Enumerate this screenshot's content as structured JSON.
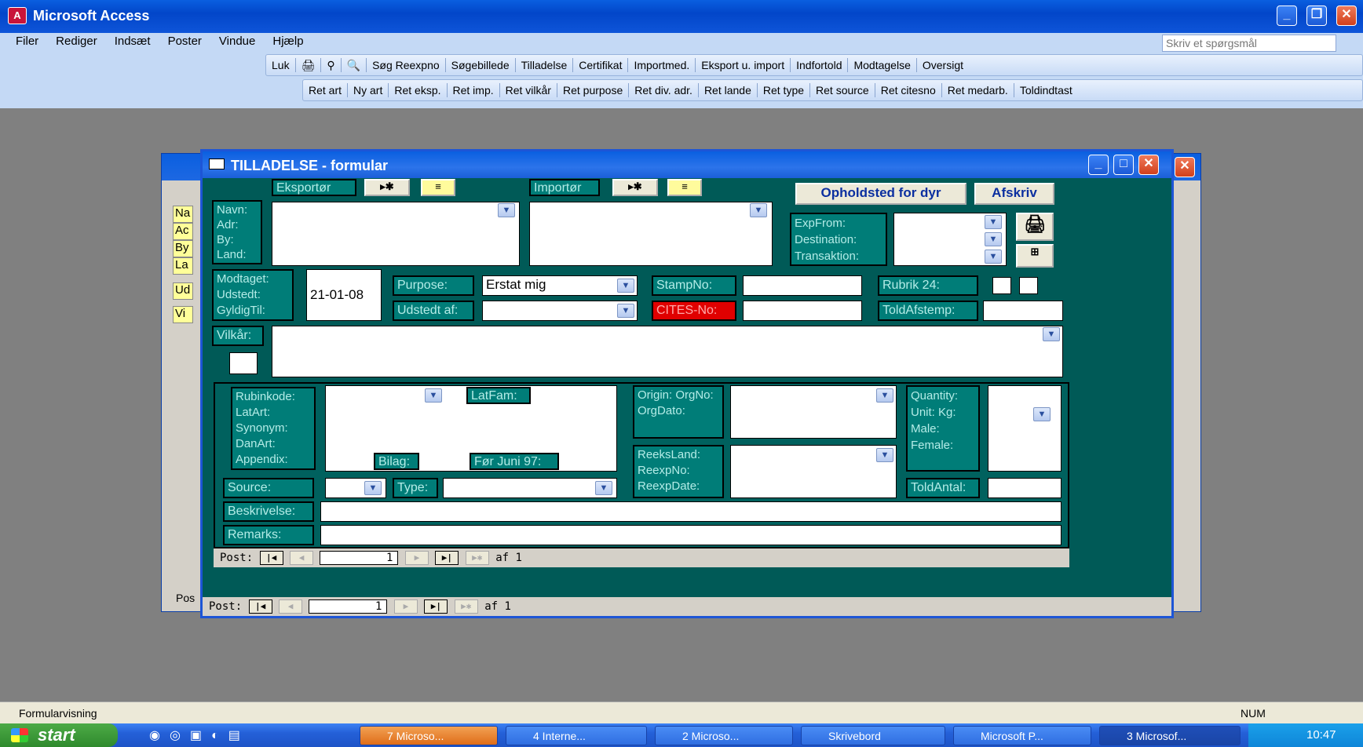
{
  "app": {
    "title": "Microsoft Access",
    "icon": "access-icon"
  },
  "menu": [
    "Filer",
    "Rediger",
    "Indsæt",
    "Poster",
    "Vindue",
    "Hjælp"
  ],
  "ask_placeholder": "Skriv et spørgsmål",
  "toolbar1": [
    "Luk",
    "Søg Reexpno",
    "Søgebillede",
    "Tilladelse",
    "Certifikat",
    "Importmed.",
    "Eksport u. import",
    "Indfortold",
    "Modtagelse",
    "Oversigt"
  ],
  "toolbar2": [
    "Ret art",
    "Ny art",
    "Ret eksp.",
    "Ret imp.",
    "Ret vilkår",
    "Ret purpose",
    "Ret div. adr.",
    "Ret lande",
    "Ret type",
    "Ret source",
    "Ret citesno",
    "Ret medarb.",
    "Toldindtast"
  ],
  "back_window": {
    "labels": [
      "Na",
      "Ac",
      "By",
      "La",
      "Ud",
      "Vi"
    ],
    "footer": "Pos"
  },
  "form": {
    "title": "TILLADELSE - formular",
    "eksportor": "Eksportør",
    "importor": "Importør",
    "opholdsted": "Opholdsted for dyr",
    "afskriv": "Afskriv",
    "addr_labels": "Navn: Adr: By: Land:",
    "exp_labels": "ExpFrom: Destination: Transaktion:",
    "date_labels": "Modtaget: Udstedt: GyldigTil:",
    "date_value": "21-01-08",
    "purpose_label": "Purpose:",
    "purpose_value": "Erstat mig",
    "udstedt_af_label": "Udstedt af:",
    "stampno_label": "StampNo:",
    "cites_label": "CITES-No:",
    "rubrik_label": "Rubrik 24:",
    "toldafstemp_label": "ToldAfstemp:",
    "vilkar_label": "Vilkår:",
    "rubin_labels": "Rubinkode: LatArt: Synonym: DanArt: Appendix:",
    "latfam_label": "LatFam:",
    "bilag_label": "Bilag:",
    "for_juni_label": "Før Juni 97:",
    "origin_labels": "Origin: OrgNo: OrgDato:",
    "reeks_labels": "ReeksLand: ReexpNo: ReexpDate:",
    "quantity_labels": "Quantity: Unit: Kg: Male: Female:",
    "source_label": "Source:",
    "type_label": "Type:",
    "toldantal_label": "ToldAntal:",
    "beskrivelse_label": "Beskrivelse:",
    "remarks_label": "Remarks:"
  },
  "nav": {
    "label": "Post:",
    "value": "1",
    "of": "af 1"
  },
  "status": {
    "text": "Formularvisning",
    "num": "NUM"
  },
  "taskbar": {
    "start": "start",
    "items": [
      "7 Microso...",
      "4 Interne...",
      "2 Microso...",
      "Skrivebord",
      "Microsoft P...",
      "3 Microsof..."
    ],
    "time": "10:47"
  }
}
